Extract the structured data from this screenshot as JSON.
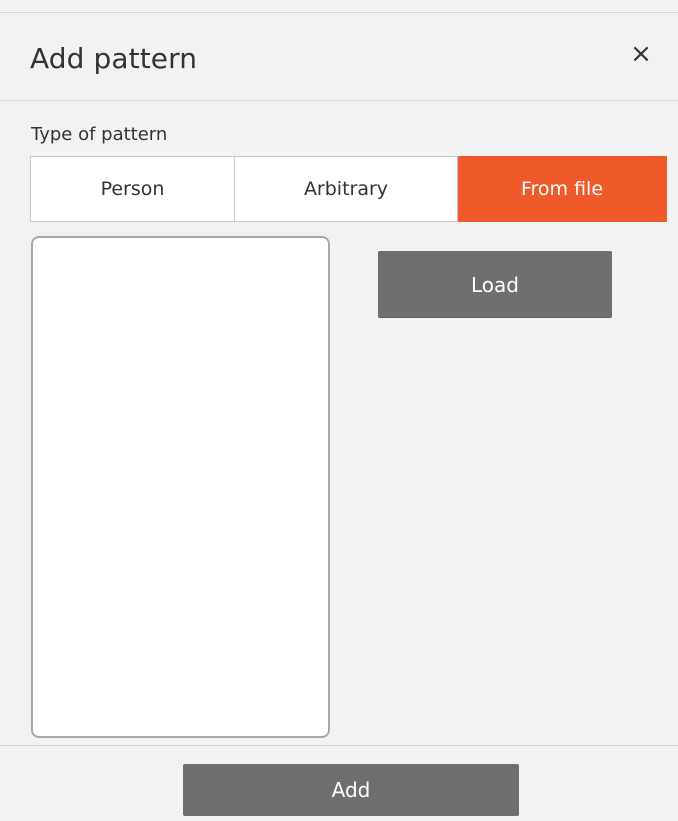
{
  "dialog": {
    "title": "Add pattern",
    "close_icon": "close-icon",
    "close_glyph": "×"
  },
  "pattern_type": {
    "label": "Type of pattern",
    "options": [
      {
        "label": "Person",
        "selected": false
      },
      {
        "label": "Arbitrary",
        "selected": false
      },
      {
        "label": "From file",
        "selected": true
      }
    ]
  },
  "file_panel": {
    "load_label": "Load"
  },
  "footer": {
    "add_label": "Add"
  },
  "colors": {
    "accent": "#f0592a",
    "button_gray": "#6f6f6f",
    "background": "#f2f2f2"
  }
}
